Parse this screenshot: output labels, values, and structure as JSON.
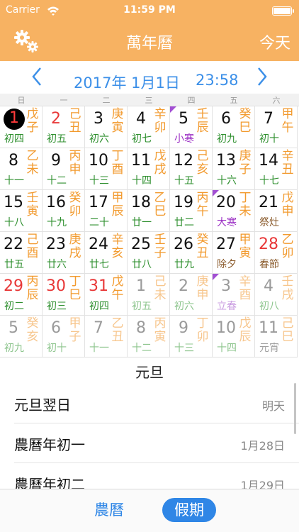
{
  "status_bar": {
    "carrier": "Carrier",
    "time": "11:59 PM",
    "wifi_icon": "wifi-icon",
    "battery_icon": "battery-icon"
  },
  "nav": {
    "title": "萬年曆",
    "today_label": "今天",
    "settings_icon": "gear-icon"
  },
  "month_bar": {
    "month": "2017年 1月1日",
    "clock": "23:58",
    "prev_icon": "chevron-left-icon",
    "next_icon": "chevron-right-icon"
  },
  "weekdays": [
    "日",
    "一",
    "二",
    "三",
    "四",
    "五",
    "六"
  ],
  "colors": {
    "accent_orange": "#f7b262",
    "blue": "#2f86e6",
    "ganzhi": "#f29a2e",
    "lunar_green": "#2e8f2e",
    "solar_term_purple": "#9b2fc4",
    "holiday_red": "#e83838"
  },
  "calendar": {
    "weeks": [
      [
        {
          "day": "1",
          "gz": "戊子",
          "lunar": "初四",
          "style": "selected",
          "ltype": "normal"
        },
        {
          "day": "2",
          "gz": "己丑",
          "lunar": "初五",
          "style": "red",
          "ltype": "normal"
        },
        {
          "day": "3",
          "gz": "庚寅",
          "lunar": "初六",
          "style": "normal",
          "ltype": "normal"
        },
        {
          "day": "4",
          "gz": "辛卯",
          "lunar": "初七",
          "style": "normal",
          "ltype": "normal"
        },
        {
          "day": "5",
          "gz": "壬辰",
          "lunar": "小寒",
          "style": "normal",
          "ltype": "term",
          "flag": true
        },
        {
          "day": "6",
          "gz": "癸巳",
          "lunar": "初九",
          "style": "normal",
          "ltype": "normal"
        },
        {
          "day": "7",
          "gz": "甲午",
          "lunar": "初十",
          "style": "normal",
          "ltype": "normal"
        }
      ],
      [
        {
          "day": "8",
          "gz": "乙未",
          "lunar": "十一",
          "style": "normal",
          "ltype": "normal"
        },
        {
          "day": "9",
          "gz": "丙申",
          "lunar": "十二",
          "style": "normal",
          "ltype": "normal"
        },
        {
          "day": "10",
          "gz": "丁酉",
          "lunar": "十三",
          "style": "normal",
          "ltype": "normal"
        },
        {
          "day": "11",
          "gz": "戊戌",
          "lunar": "十四",
          "style": "normal",
          "ltype": "normal"
        },
        {
          "day": "12",
          "gz": "己亥",
          "lunar": "十五",
          "style": "normal",
          "ltype": "normal"
        },
        {
          "day": "13",
          "gz": "庚子",
          "lunar": "十六",
          "style": "normal",
          "ltype": "normal"
        },
        {
          "day": "14",
          "gz": "辛丑",
          "lunar": "十七",
          "style": "normal",
          "ltype": "normal"
        }
      ],
      [
        {
          "day": "15",
          "gz": "壬寅",
          "lunar": "十八",
          "style": "normal",
          "ltype": "normal"
        },
        {
          "day": "16",
          "gz": "癸卯",
          "lunar": "十九",
          "style": "normal",
          "ltype": "normal"
        },
        {
          "day": "17",
          "gz": "甲辰",
          "lunar": "二十",
          "style": "normal",
          "ltype": "normal"
        },
        {
          "day": "18",
          "gz": "乙巳",
          "lunar": "廿一",
          "style": "normal",
          "ltype": "normal"
        },
        {
          "day": "19",
          "gz": "丙午",
          "lunar": "廿二",
          "style": "normal",
          "ltype": "normal"
        },
        {
          "day": "20",
          "gz": "丁未",
          "lunar": "大寒",
          "style": "normal",
          "ltype": "term",
          "flag": true
        },
        {
          "day": "21",
          "gz": "戊申",
          "lunar": "祭灶",
          "style": "normal",
          "ltype": "festival"
        }
      ],
      [
        {
          "day": "22",
          "gz": "己酉",
          "lunar": "廿五",
          "style": "normal",
          "ltype": "normal"
        },
        {
          "day": "23",
          "gz": "庚戌",
          "lunar": "廿六",
          "style": "normal",
          "ltype": "normal"
        },
        {
          "day": "24",
          "gz": "辛亥",
          "lunar": "廿七",
          "style": "normal",
          "ltype": "normal"
        },
        {
          "day": "25",
          "gz": "壬子",
          "lunar": "廿八",
          "style": "normal",
          "ltype": "normal"
        },
        {
          "day": "26",
          "gz": "癸丑",
          "lunar": "廿九",
          "style": "normal",
          "ltype": "normal"
        },
        {
          "day": "27",
          "gz": "甲寅",
          "lunar": "除夕",
          "style": "normal",
          "ltype": "festival"
        },
        {
          "day": "28",
          "gz": "乙卯",
          "lunar": "春節",
          "style": "red",
          "ltype": "festival"
        }
      ],
      [
        {
          "day": "29",
          "gz": "丙辰",
          "lunar": "初二",
          "style": "red",
          "ltype": "normal"
        },
        {
          "day": "30",
          "gz": "丁巳",
          "lunar": "初三",
          "style": "red",
          "ltype": "normal"
        },
        {
          "day": "31",
          "gz": "戊午",
          "lunar": "初四",
          "style": "red",
          "ltype": "normal"
        },
        {
          "day": "1",
          "gz": "己未",
          "lunar": "初五",
          "style": "dim",
          "ltype": "dimg"
        },
        {
          "day": "2",
          "gz": "庚申",
          "lunar": "初六",
          "style": "dim",
          "ltype": "dimg"
        },
        {
          "day": "3",
          "gz": "辛酉",
          "lunar": "立春",
          "style": "dim",
          "ltype": "dimterm",
          "flag": true
        },
        {
          "day": "4",
          "gz": "壬戌",
          "lunar": "初八",
          "style": "dim",
          "ltype": "dimg"
        }
      ],
      [
        {
          "day": "5",
          "gz": "癸亥",
          "lunar": "初九",
          "style": "dim",
          "ltype": "dimg"
        },
        {
          "day": "6",
          "gz": "甲子",
          "lunar": "初十",
          "style": "dim",
          "ltype": "dimg"
        },
        {
          "day": "7",
          "gz": "乙丑",
          "lunar": "十一",
          "style": "dim",
          "ltype": "dimg"
        },
        {
          "day": "8",
          "gz": "丙寅",
          "lunar": "十二",
          "style": "dim",
          "ltype": "dimg"
        },
        {
          "day": "9",
          "gz": "丁卯",
          "lunar": "十三",
          "style": "dim",
          "ltype": "dimg"
        },
        {
          "day": "10",
          "gz": "戊辰",
          "lunar": "十四",
          "style": "dim",
          "ltype": "dimg"
        },
        {
          "day": "11",
          "gz": "己巳",
          "lunar": "元宵",
          "style": "dim",
          "ltype": "dimfest"
        }
      ]
    ]
  },
  "holiday_panel": {
    "title": "元旦",
    "items": [
      {
        "name": "元旦翌日",
        "date": "明天"
      },
      {
        "name": "農曆年初一",
        "date": "1月28日"
      },
      {
        "name": "農曆年初二",
        "date": "1月29日"
      }
    ]
  },
  "tabs": {
    "lunar_label": "農曆",
    "holiday_label": "假期"
  }
}
